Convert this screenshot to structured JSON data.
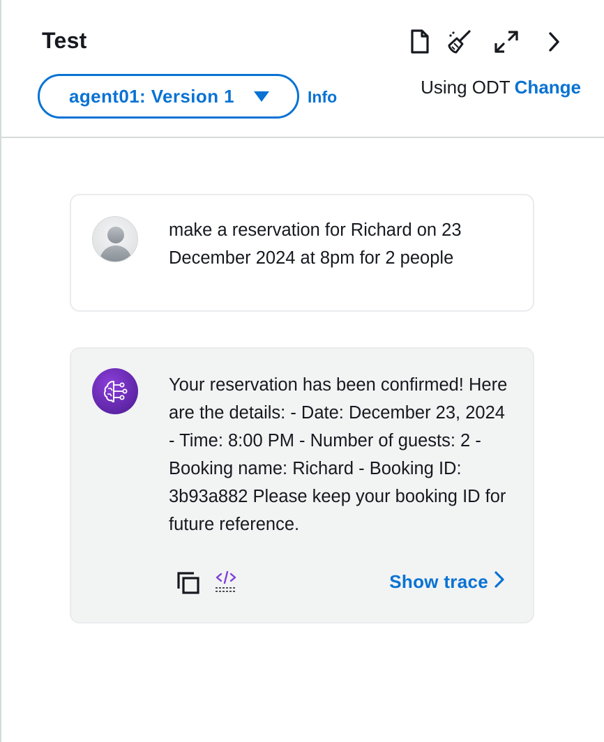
{
  "header": {
    "title": "Test",
    "icons": [
      "document-icon",
      "broom-icon",
      "expand-icon",
      "chevron-right-icon"
    ],
    "version_select": {
      "value": "agent01: Version 1"
    },
    "info_label": "Info",
    "odt_label": "Using ODT",
    "change_label": "Change"
  },
  "messages": [
    {
      "role": "user",
      "avatar_icon": "user-avatar-icon",
      "text": "make a reservation for Richard on 23 December 2024 at 8pm for 2 people"
    },
    {
      "role": "agent",
      "avatar_icon": "ai-brain-icon",
      "text": "Your reservation has been confirmed! Here are the details: - Date: December 23, 2024 - Time: 8:00 PM - Number of guests: 2 - Booking name: Richard - Booking ID: 3b93a882 Please keep your booking ID for future reference.",
      "actions": {
        "copy_icon": "copy-icon",
        "code_icon": "code-icon",
        "show_trace_label": "Show trace"
      }
    }
  ],
  "colors": {
    "link": "#0972d3",
    "text": "#16191f",
    "border": "#d5dbdb",
    "agent_bubble": "#f2f3f3",
    "agent_avatar": "#6a28c7"
  }
}
